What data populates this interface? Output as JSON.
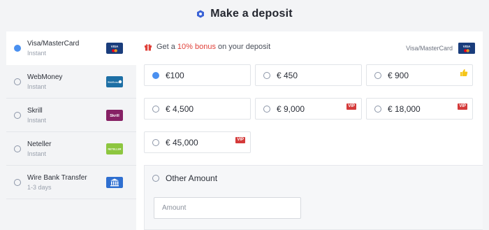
{
  "header": {
    "title": "Make a deposit",
    "logo_icon": "hexagon-logo-icon"
  },
  "sidebar": {
    "items": [
      {
        "name": "Visa/MasterCard",
        "sub": "Instant",
        "logo": "visa-mastercard-logo",
        "logo_bg": "#1a3d7c",
        "logo_text": "VISA",
        "selected": true
      },
      {
        "name": "WebMoney",
        "sub": "Instant",
        "logo": "webmoney-logo",
        "logo_bg": "#1d6fa5",
        "logo_text": "WebMoney",
        "selected": false
      },
      {
        "name": "Skrill",
        "sub": "Instant",
        "logo": "skrill-logo",
        "logo_bg": "#862165",
        "logo_text": "Skrill",
        "selected": false
      },
      {
        "name": "Neteller",
        "sub": "Instant",
        "logo": "neteller-logo",
        "logo_bg": "#8dc63f",
        "logo_text": "NETELLER",
        "selected": false
      },
      {
        "name": "Wire Bank Transfer",
        "sub": "1-3 days",
        "logo": "bank-icon",
        "logo_bg": "#2f6fd0",
        "logo_text": "",
        "selected": false
      }
    ]
  },
  "bonus": {
    "prefix": "Get a",
    "highlight": "10% bonus",
    "suffix": "on your deposit",
    "card_label": "Visa/MasterCard",
    "accent": "#e0413a"
  },
  "amounts": [
    {
      "value": "€100",
      "selected": true,
      "badge": ""
    },
    {
      "value": "€ 450",
      "selected": false,
      "badge": ""
    },
    {
      "value": "€ 900",
      "selected": false,
      "badge": "thumbs-up"
    },
    {
      "value": "€ 4,500",
      "selected": false,
      "badge": ""
    },
    {
      "value": "€ 9,000",
      "selected": false,
      "badge": "VIP"
    },
    {
      "value": "€ 18,000",
      "selected": false,
      "badge": "VIP"
    },
    {
      "value": "€ 45,000",
      "selected": false,
      "badge": "VIP"
    }
  ],
  "other": {
    "label": "Other Amount",
    "placeholder": "Amount"
  },
  "colors": {
    "radio_selected": "#4a90f0",
    "vip": "#d43a3a",
    "thumbs_up": "#f5c518"
  }
}
